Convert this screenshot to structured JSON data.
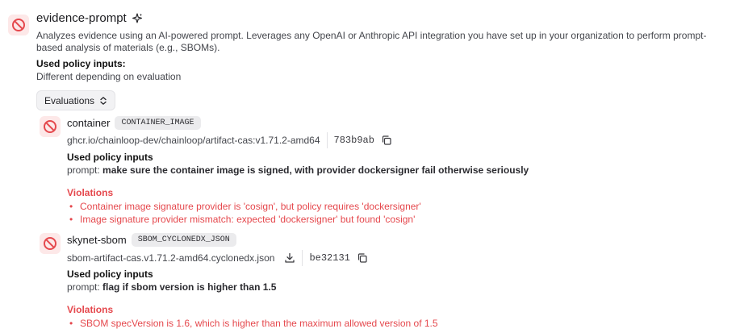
{
  "policy": {
    "name": "evidence-prompt",
    "description": "Analyzes evidence using an AI-powered prompt. Leverages any OpenAI or Anthropic API integration you have set up in your organization to perform prompt-based analysis of materials (e.g., SBOMs).",
    "used_inputs_label": "Used policy inputs:",
    "used_inputs_value": "Different depending on evaluation",
    "evaluations_button": "Evaluations"
  },
  "evaluations": [
    {
      "name": "container",
      "kind": "CONTAINER_IMAGE",
      "reference": "ghcr.io/chainloop-dev/chainloop/artifact-cas:v1.71.2-amd64",
      "digest": "783b9ab",
      "inputs_label": "Used policy inputs",
      "input_key": "prompt:",
      "input_value": "make sure the container image is signed, with provider dockersigner fail otherwise seriously",
      "violations_label": "Violations",
      "violations": [
        "Container image signature provider is 'cosign', but policy requires 'dockersigner'",
        "Image signature provider mismatch: expected 'dockersigner' but found 'cosign'"
      ]
    },
    {
      "name": "skynet-sbom",
      "kind": "SBOM_CYCLONEDX_JSON",
      "reference": "sbom-artifact-cas.v1.71.2-amd64.cyclonedx.json",
      "digest": "be32131",
      "inputs_label": "Used policy inputs",
      "input_key": "prompt:",
      "input_value": "flag if sbom version is higher than 1.5",
      "violations_label": "Violations",
      "violations": [
        "SBOM specVersion is 1.6, which is higher than the maximum allowed version of 1.5"
      ]
    }
  ],
  "colors": {
    "violation": "#e5484d",
    "status_bg": "#fde8e8"
  },
  "icons": {
    "status": "blocked-circle-icon",
    "ai": "sparkles-icon",
    "dropdown": "chevron-up-down-icon",
    "copy": "copy-icon",
    "download": "download-icon"
  }
}
